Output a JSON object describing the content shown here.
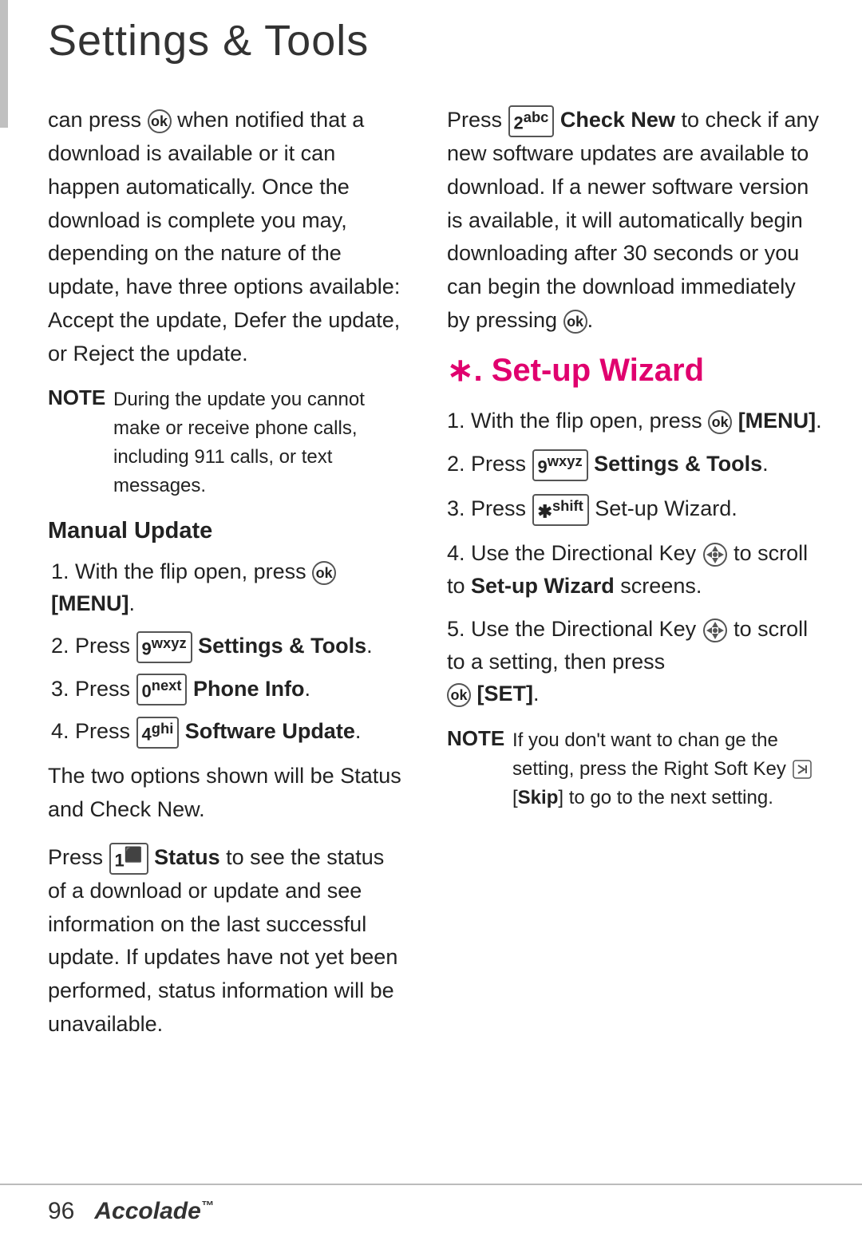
{
  "page": {
    "title": "Settings & Tools",
    "footer_page": "96",
    "footer_brand": "Accolade",
    "footer_tm": "™"
  },
  "left_column": {
    "intro": "can press  when notified that a download is available or it can happen automatically. Once the download is complete you may, depending on the nature of the update, have three options available: Accept the update, Defer the update, or Reject the update.",
    "note_label": "NOTE",
    "note_text": "During the update you cannot make or receive phone calls, including 911  calls, or text messages.",
    "manual_update_heading": "Manual Update",
    "steps": [
      "1. With the flip open, press  [MENU].",
      "2. Press  Settings & Tools.",
      "3. Press  Phone Info.",
      "4. Press  Software Update."
    ],
    "status_para": "The two options shown will be Status and Check New.",
    "status_press": "Press  Status to see the status of a download or update and see information on the last successful update. If updates have not yet been performed, status information will be unavailable."
  },
  "right_column": {
    "check_new_para": "Press  Check New to check if any new software updates are available to download. If a newer software version is available, it will automatically begin downloading after 30 seconds or you can begin the download immediately by pressing .",
    "setup_wizard_title": "∗. Set-up Wizard",
    "steps": [
      "1. With the flip open, press  [MENU].",
      "2. Press  Settings & Tools.",
      "3. Press  Set-up Wizard.",
      "4. Use the Directional Key  to scroll to Set-up Wizard screens.",
      "5. Use the Directional Key  to scroll to a setting, then press  [SET]."
    ],
    "note_label": "NOTE",
    "note_text": "If you don't want to chan ge the setting, press the Right Soft Key  [Skip] to go to the next setting."
  }
}
